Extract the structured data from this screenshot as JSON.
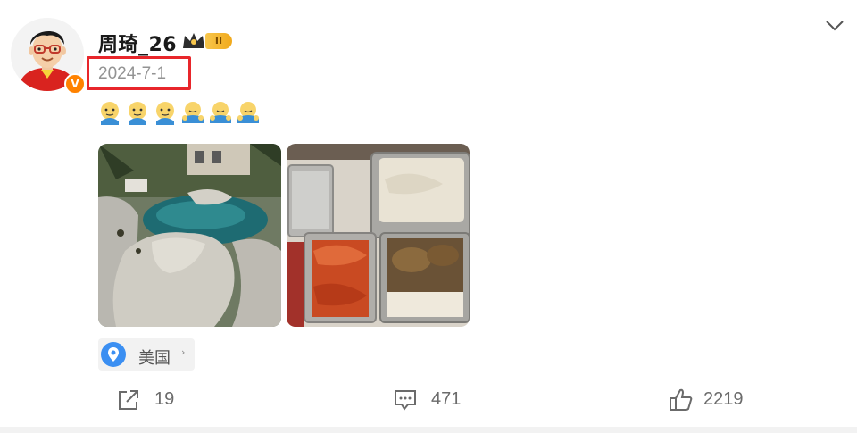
{
  "post": {
    "username": "周琦_26",
    "vip_level": "II",
    "date": "2024-7-1",
    "verified_mark": "V",
    "emojis": [
      "doge-face-icon",
      "doge-face-icon",
      "doge-face-icon",
      "hug-face-icon",
      "hug-face-icon",
      "hug-face-icon"
    ],
    "images": [
      {
        "name": "pool-photo",
        "subject": "poolside rock waterfall"
      },
      {
        "name": "food-photo",
        "subject": "takeout food trays"
      }
    ],
    "location": "美国",
    "location_arrow": "›"
  },
  "actions": {
    "repost_count": "19",
    "comment_count": "471",
    "like_count": "2219"
  },
  "colors": {
    "highlight_box": "#e8262b",
    "verified": "#ff8200",
    "location_pin": "#3b8ff2",
    "text_muted": "#939393"
  }
}
